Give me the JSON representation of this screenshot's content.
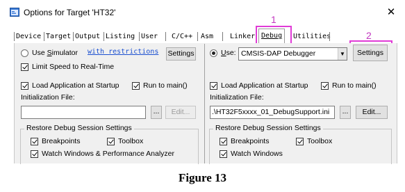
{
  "window": {
    "title": "Options for Target 'HT32'",
    "close_glyph": "✕"
  },
  "tabs": [
    {
      "label": "Device"
    },
    {
      "label": "Target"
    },
    {
      "label": "Output"
    },
    {
      "label": "Listing"
    },
    {
      "label": "User"
    },
    {
      "label": "C/C++"
    },
    {
      "label": "Asm"
    },
    {
      "label": "Linker"
    },
    {
      "label": "Debug",
      "selected": true
    },
    {
      "label": "Utilities"
    }
  ],
  "annotations": {
    "one": "1",
    "two": "2",
    "color": "#e03bd6"
  },
  "left": {
    "use_simulator_label": "Use Simulator",
    "use_simulator_selected": false,
    "restrictions_link": "with restrictions",
    "settings_label": "Settings",
    "limit_speed_label": "Limit Speed to Real-Time",
    "limit_speed_checked": true,
    "load_app_label": "Load Application at Startup",
    "load_app_checked": true,
    "run_to_main_label": "Run to main()",
    "run_to_main_checked": true,
    "init_file_label": "Initialization File:",
    "init_file_value": "",
    "browse_label": "...",
    "edit_label": "Edit...",
    "restore_group_label": "Restore Debug Session Settings",
    "breakpoints_label": "Breakpoints",
    "breakpoints_checked": true,
    "toolbox_label": "Toolbox",
    "toolbox_checked": true,
    "watch_label": "Watch Windows & Performance Analyzer",
    "watch_checked": true
  },
  "right": {
    "use_label": "Use:",
    "use_selected": true,
    "debugger_value": "CMSIS-DAP Debugger",
    "settings_label": "Settings",
    "load_app_label": "Load Application at Startup",
    "load_app_checked": true,
    "run_to_main_label": "Run to main()",
    "run_to_main_checked": true,
    "init_file_label": "Initialization File:",
    "init_file_value": ".\\HT32F5xxxx_01_DebugSupport.ini",
    "browse_label": "...",
    "edit_label": "Edit...",
    "restore_group_label": "Restore Debug Session Settings",
    "breakpoints_label": "Breakpoints",
    "breakpoints_checked": true,
    "toolbox_label": "Toolbox",
    "toolbox_checked": true,
    "watch_label": "Watch Windows",
    "watch_checked": true
  },
  "caption": "Figure 13"
}
